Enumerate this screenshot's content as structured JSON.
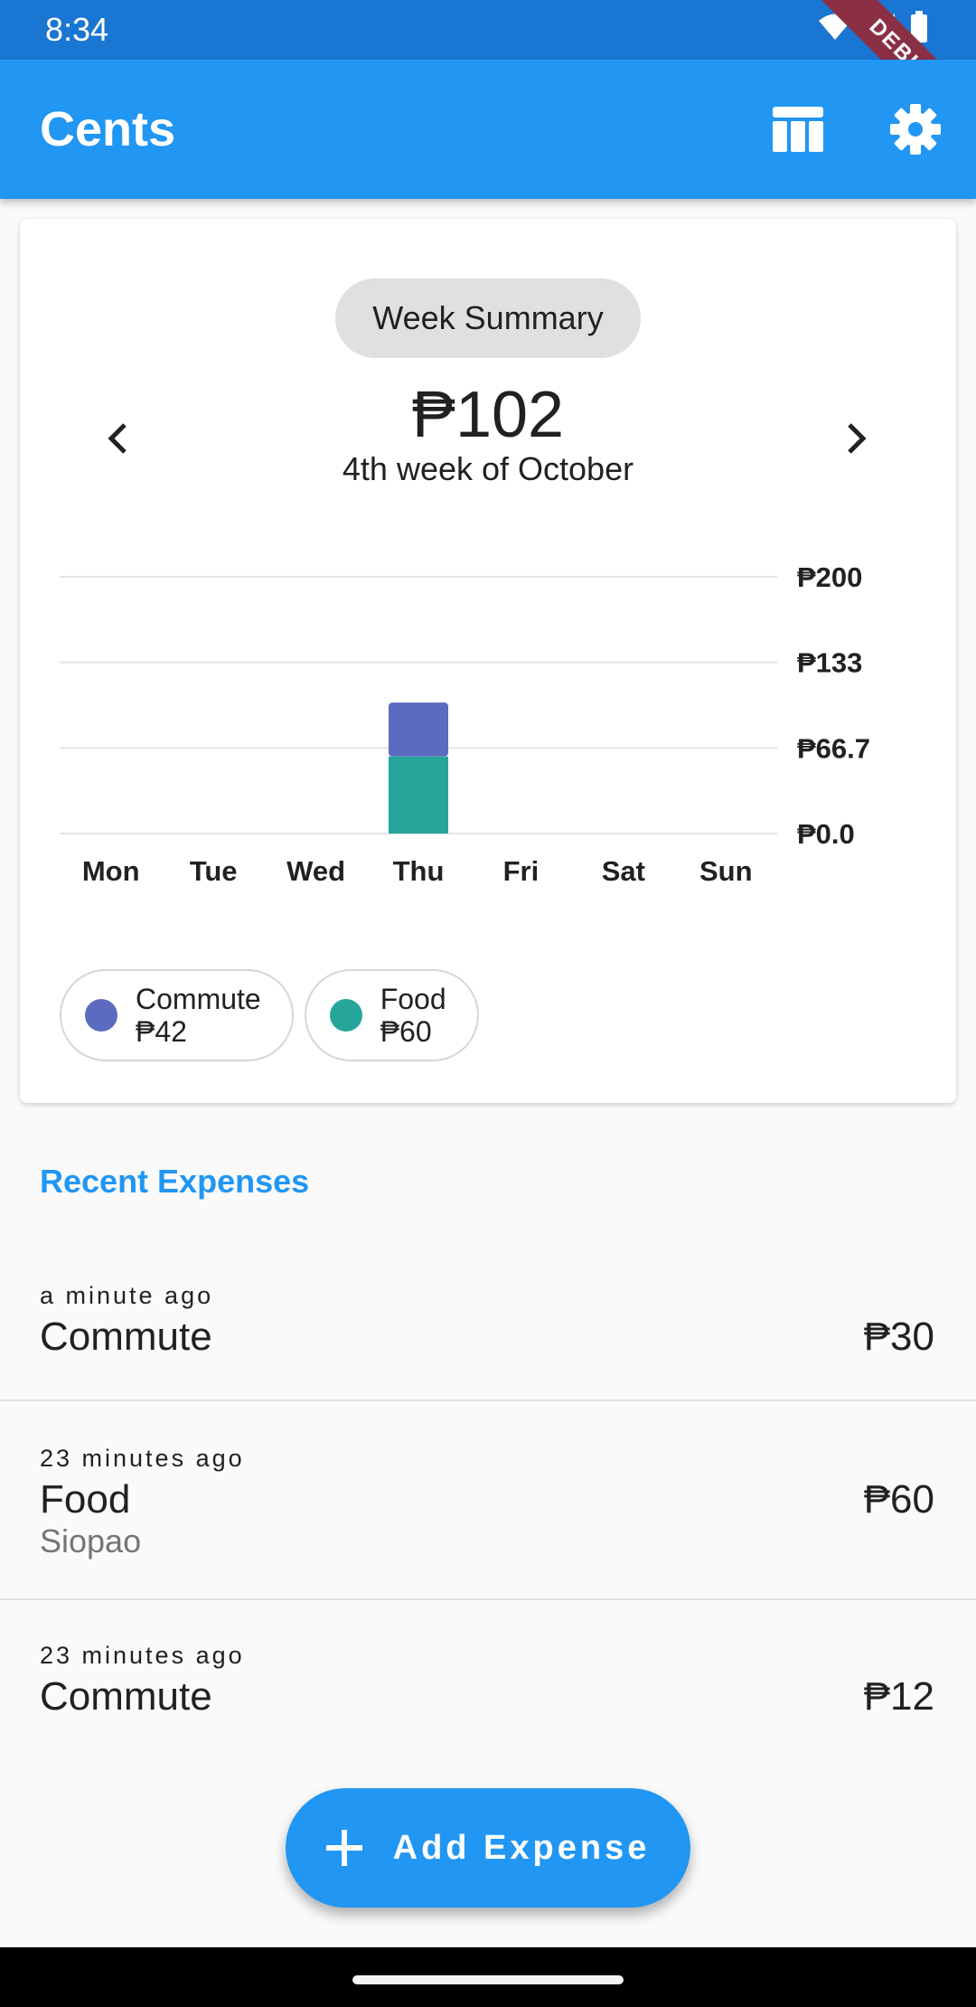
{
  "status_bar": {
    "time": "8:34",
    "debug_label": "DEBUG"
  },
  "app_bar": {
    "title": "Cents"
  },
  "summary": {
    "chip_label": "Week Summary",
    "total": "₱102",
    "period": "4th week of October"
  },
  "chart_data": {
    "type": "bar",
    "stacked": true,
    "categories": [
      "Mon",
      "Tue",
      "Wed",
      "Thu",
      "Fri",
      "Sat",
      "Sun"
    ],
    "series": [
      {
        "name": "Food",
        "color": "#26a69a",
        "values": [
          0,
          0,
          0,
          60,
          0,
          0,
          0
        ]
      },
      {
        "name": "Commute",
        "color": "#5c6bc0",
        "values": [
          0,
          0,
          0,
          42,
          0,
          0,
          0
        ]
      }
    ],
    "y_ticks": [
      "₱0.0",
      "₱66.7",
      "₱133",
      "₱200"
    ],
    "ylim": [
      0,
      200
    ],
    "grid": true,
    "y_axis_side": "right"
  },
  "legend": [
    {
      "name": "Commute",
      "amount": "₱42",
      "color": "#5c6bc0"
    },
    {
      "name": "Food",
      "amount": "₱60",
      "color": "#26a69a"
    }
  ],
  "recent": {
    "title": "Recent Expenses",
    "items": [
      {
        "time": "a minute ago",
        "category": "Commute",
        "note": "",
        "amount": "₱30"
      },
      {
        "time": "23 minutes ago",
        "category": "Food",
        "note": "Siopao",
        "amount": "₱60"
      },
      {
        "time": "23 minutes ago",
        "category": "Commute",
        "note": "",
        "amount": "₱12"
      }
    ]
  },
  "fab": {
    "label": "Add Expense"
  }
}
